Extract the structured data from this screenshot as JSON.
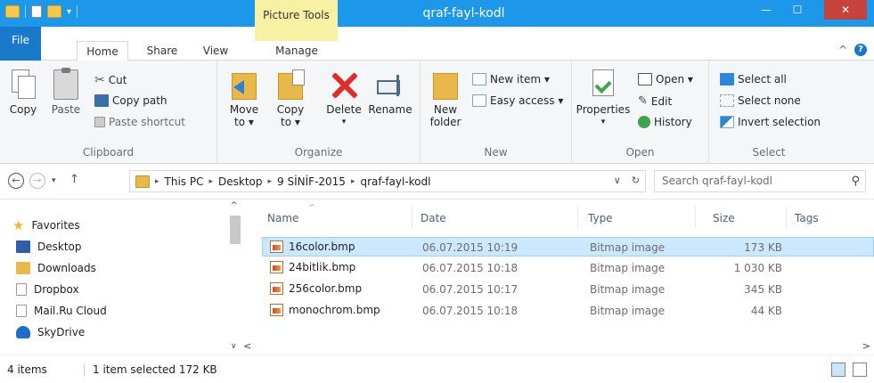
{
  "window": {
    "title": "qraf-fayl-kodl",
    "context_tab": "Picture Tools",
    "minimize": "—",
    "maximize": "☐",
    "close": "✕"
  },
  "tabs": {
    "file": "File",
    "home": "Home",
    "share": "Share",
    "view": "View",
    "manage": "Manage",
    "collapse": "^",
    "help": "?"
  },
  "ribbon": {
    "clipboard": {
      "label": "Clipboard",
      "copy": "Copy",
      "paste": "Paste",
      "cut": "Cut",
      "copy_path": "Copy path",
      "paste_shortcut": "Paste shortcut"
    },
    "organize": {
      "label": "Organize",
      "move_to_1": "Move",
      "move_to_2": "to ▾",
      "copy_to_1": "Copy",
      "copy_to_2": "to ▾",
      "delete": "Delete",
      "delete_arrow": "▾",
      "rename": "Rename"
    },
    "new": {
      "label": "New",
      "new_folder_1": "New",
      "new_folder_2": "folder",
      "new_item": "New item ▾",
      "easy_access": "Easy access ▾"
    },
    "open": {
      "label": "Open",
      "properties": "Properties",
      "properties_arrow": "▾",
      "open": "Open ▾",
      "edit": "Edit",
      "history": "History"
    },
    "select": {
      "label": "Select",
      "select_all": "Select all",
      "select_none": "Select none",
      "invert": "Invert selection"
    }
  },
  "address": {
    "back": "←",
    "forward": "→",
    "recent": "▾",
    "up": "↑",
    "sep": "▸",
    "crumbs": [
      "This PC",
      "Desktop",
      "9 SİNİF-2015",
      "qraf-fayl-kodl"
    ],
    "dropdown": "∨",
    "refresh": "↻",
    "search_placeholder": "Search qraf-fayl-kodl",
    "search_icon": "⚲"
  },
  "navpane": {
    "favorites": "Favorites",
    "items": [
      "Desktop",
      "Downloads",
      "Dropbox",
      "Mail.Ru Cloud",
      "SkyDrive"
    ],
    "scroll_up": "^",
    "scroll_down": "∨"
  },
  "columns": {
    "name": "Name",
    "date": "Date",
    "type": "Type",
    "size": "Size",
    "tags": "Tags",
    "sort": "^"
  },
  "files": [
    {
      "name": "16color.bmp",
      "date": "06.07.2015 10:19",
      "type": "Bitmap image",
      "size": "173 KB"
    },
    {
      "name": "24bitlik.bmp",
      "date": "06.07.2015 10:18",
      "type": "Bitmap image",
      "size": "1 030 KB"
    },
    {
      "name": "256color.bmp",
      "date": "06.07.2015 10:17",
      "type": "Bitmap image",
      "size": "345 KB"
    },
    {
      "name": "monochrom.bmp",
      "date": "06.07.2015 10:18",
      "type": "Bitmap image",
      "size": "44 KB"
    }
  ],
  "hscroll": {
    "left": "<",
    "right": ">"
  },
  "status": {
    "count": "4 items",
    "selected": "1 item selected  172 KB"
  },
  "colors": {
    "titlebar": "#1c97ea",
    "file_tab": "#1979ca",
    "picture_tools": "#f8f0a3",
    "selection": "#cce8ff",
    "close_button": "#c7423a"
  }
}
